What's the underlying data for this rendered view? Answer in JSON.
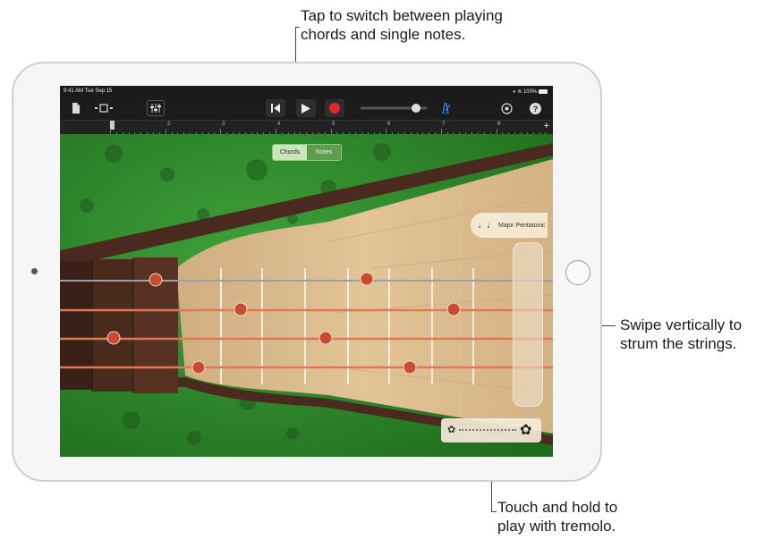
{
  "callouts": {
    "top": [
      "Tap to switch between playing",
      "chords and single notes."
    ],
    "right": [
      "Swipe vertically to",
      "strum the strings."
    ],
    "bottom": [
      "Touch and hold to",
      "play with tremolo."
    ]
  },
  "status": {
    "time": "9:41 AM  Tue Sep 15",
    "battery": "100%"
  },
  "ruler": {
    "marks": [
      "1",
      "2",
      "3",
      "4",
      "5",
      "6",
      "7",
      "8"
    ],
    "add": "+"
  },
  "toggle": {
    "chords": "Chords",
    "notes": "Notes"
  },
  "scale": {
    "label": "Major Pentatonic"
  },
  "colors": {
    "silk": "#2e8b2a",
    "wood": "#d8b98e",
    "string": "#e07a55",
    "record": "#e0282a",
    "metronome": "#3b8bef"
  }
}
